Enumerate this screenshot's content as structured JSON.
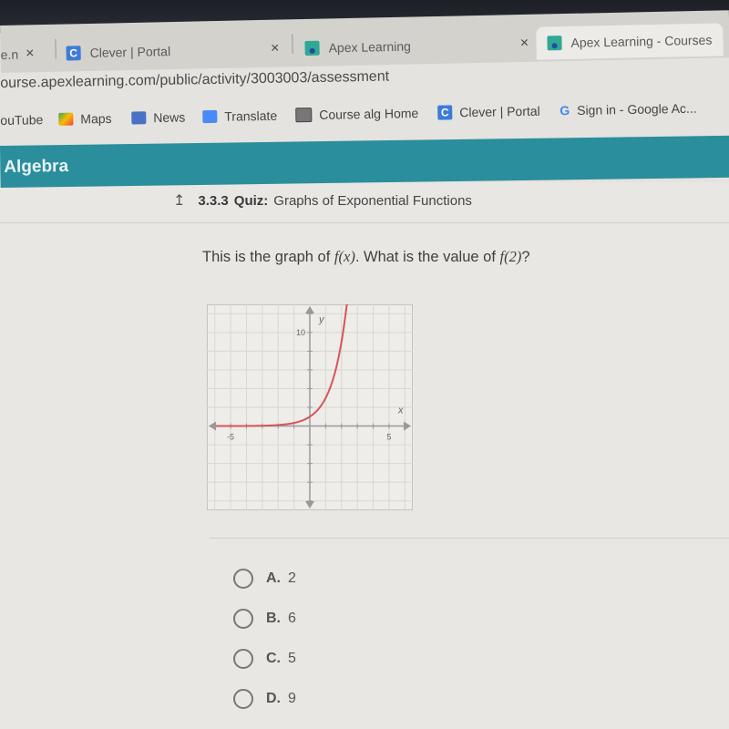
{
  "browser": {
    "tabs": [
      {
        "label": "e.n",
        "close": "×",
        "active": false
      },
      {
        "label": "Clever | Portal",
        "close": "×",
        "active": false,
        "icon": "clever-icon"
      },
      {
        "label": "Apex Learning",
        "close": "×",
        "active": false,
        "icon": "apex-icon"
      },
      {
        "label": "Apex Learning - Courses",
        "active": true,
        "icon": "apex-icon"
      }
    ],
    "url": "ourse.apexlearning.com/public/activity/3003003/assessment",
    "bookmarks": [
      {
        "label": "ouTube"
      },
      {
        "label": "Maps",
        "icon": "maps-icon"
      },
      {
        "label": "News",
        "icon": "news-icon"
      },
      {
        "label": "Translate",
        "icon": "translate-icon"
      },
      {
        "label": "Course alg Home",
        "icon": "page-icon"
      },
      {
        "label": "Clever | Portal",
        "icon": "clever-icon"
      },
      {
        "label": "Sign in - Google Ac...",
        "icon": "google-icon"
      }
    ]
  },
  "app": {
    "course_title": "Algebra",
    "quiz_number": "3.3.3",
    "quiz_label": "Quiz:",
    "quiz_title": "Graphs of Exponential Functions",
    "accent_color": "#2a8e9c"
  },
  "question": {
    "text_prefix": "This is the graph of ",
    "fx": "f(x)",
    "text_middle": ". What is the value of ",
    "f2": "f(2)",
    "text_suffix": "?"
  },
  "choices": [
    {
      "letter": "A.",
      "value": "2"
    },
    {
      "letter": "B.",
      "value": "6"
    },
    {
      "letter": "C.",
      "value": "5"
    },
    {
      "letter": "D.",
      "value": "9"
    }
  ],
  "chart_data": {
    "type": "line",
    "function": "3^x",
    "x": [
      -7,
      -6,
      -5,
      -4,
      -3,
      -2,
      -1,
      0,
      1,
      2
    ],
    "y": [
      0.0005,
      0.0014,
      0.0041,
      0.0123,
      0.037,
      0.111,
      0.333,
      1,
      3,
      9
    ],
    "xlabel": "x",
    "ylabel": "y",
    "xlim": [
      -6.5,
      6.5
    ],
    "ylim": [
      -9,
      13
    ],
    "x_tick_labels": [
      {
        "value": -5,
        "label": "-5"
      },
      {
        "value": 5,
        "label": "5"
      }
    ],
    "y_tick_labels": [
      {
        "value": 10,
        "label": "10"
      }
    ],
    "x_tick_step": 1,
    "y_tick_step": 2,
    "grid": true,
    "curve_color": "#d9545a"
  }
}
